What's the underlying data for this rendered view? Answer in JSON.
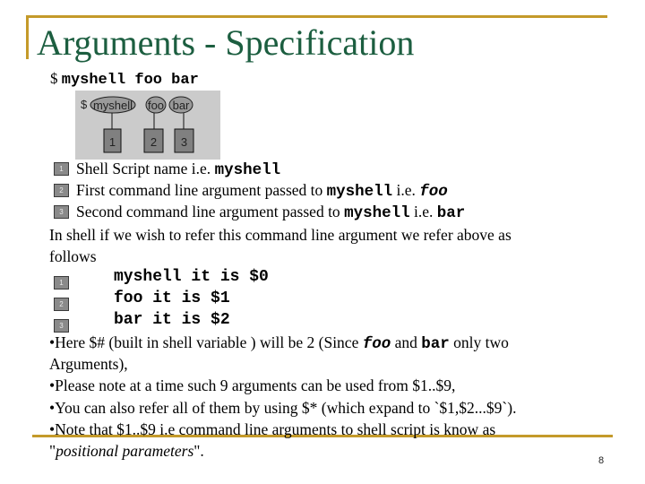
{
  "slide": {
    "title": "Arguments - Specification",
    "page_number": "8",
    "accent_color": "#c49a2a",
    "title_color": "#1c5e40"
  },
  "command": {
    "prompt": "$",
    "text": "myshell foo bar"
  },
  "diagram": {
    "prompt": "$",
    "tokens": [
      "myshell",
      "foo",
      "bar"
    ],
    "numbers": [
      "1",
      "2",
      "3"
    ]
  },
  "legend": [
    {
      "num": "1",
      "text": "Shell Script name i.e. ",
      "code": "myshell",
      "tail": "",
      "tail_code": ""
    },
    {
      "num": "2",
      "text": "First command line argument passed to ",
      "code": "myshell",
      "tail": " i.e. ",
      "tail_code": "foo"
    },
    {
      "num": "3",
      "text": "Second command line argument passed to ",
      "code": "myshell",
      "tail": " i.e. ",
      "tail_code": "bar"
    }
  ],
  "intro": {
    "line1": "In shell if we wish to refer this command line argument we refer above as",
    "line2": "follows"
  },
  "refs": [
    {
      "num": "1",
      "code": "myshell it is $0"
    },
    {
      "num": "2",
      "code": "foo it is $1"
    },
    {
      "num": "3",
      "code": "bar it is $2"
    }
  ],
  "bullets": {
    "b1_pre": "•Here $# (built in shell variable ) will be 2 (Since ",
    "b1_foo": "foo",
    "b1_mid": " and ",
    "b1_bar": "bar",
    "b1_post": " only two",
    "b1_line2": "Arguments),",
    "b2": "•Please note at a time such 9 arguments can be used from $1..$9,",
    "b3": "•You can also refer all of them by using $* (which expand to `$1,$2...$9`).",
    "b4": "•Note that $1..$9 i.e command line arguments to shell script is know as",
    "b4_q1": "\"",
    "b4_italic": "positional parameters",
    "b4_q2": "\"."
  }
}
